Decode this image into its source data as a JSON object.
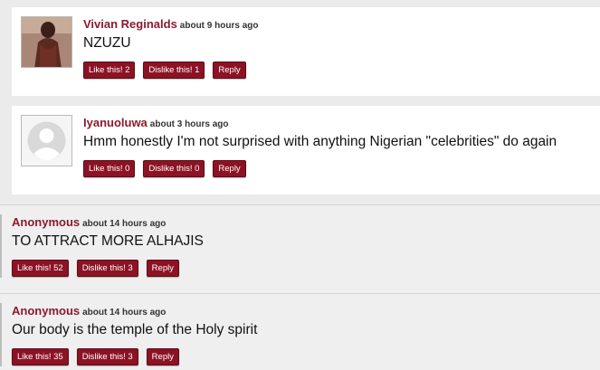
{
  "comments": [
    {
      "author": "Vivian Reginalds",
      "time": "about 9 hours ago",
      "text": "NZUZU",
      "like_label": "Like this! 2",
      "dislike_label": "Dislike this! 1",
      "reply_label": "Reply"
    },
    {
      "author": "Iyanuoluwa",
      "time": "about 3 hours ago",
      "text": "Hmm honestly I'm not surprised with anything Nigerian \"celebrities\" do again",
      "like_label": "Like this! 0",
      "dislike_label": "Dislike this! 0",
      "reply_label": "Reply"
    },
    {
      "author": "Anonymous",
      "time": "about 14 hours ago",
      "text": "TO ATTRACT MORE ALHAJIS",
      "like_label": "Like this! 52",
      "dislike_label": "Dislike this! 3",
      "reply_label": "Reply"
    },
    {
      "author": "Anonymous",
      "time": "about 14 hours ago",
      "text": "Our body is the temple of the Holy spirit",
      "like_label": "Like this! 35",
      "dislike_label": "Dislike this! 3",
      "reply_label": "Reply"
    }
  ],
  "colors": {
    "accent": "#8b1324",
    "author": "#8b1a2b"
  }
}
